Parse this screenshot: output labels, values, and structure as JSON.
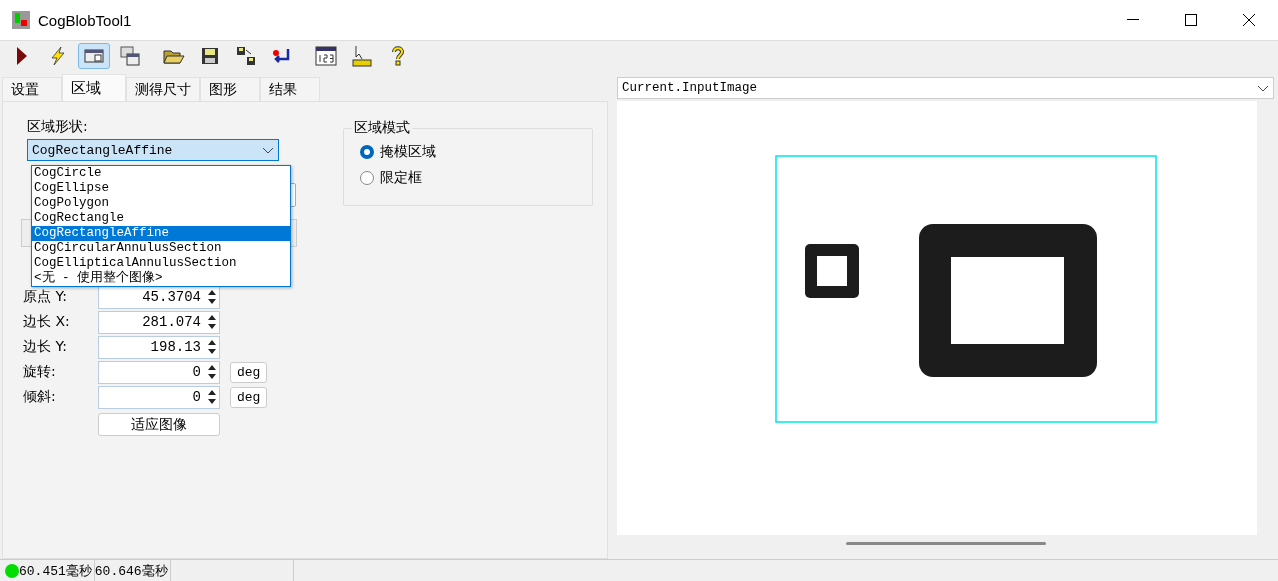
{
  "window": {
    "title": "CogBlobTool1"
  },
  "toolbar": [
    {
      "kind": "run",
      "selected": false
    },
    {
      "kind": "flash",
      "selected": false
    },
    {
      "kind": "panel",
      "selected": true
    },
    {
      "kind": "panels",
      "selected": false
    },
    {
      "kind": "open",
      "selected": false
    },
    {
      "kind": "save",
      "selected": false
    },
    {
      "kind": "saveas",
      "selected": false
    },
    {
      "kind": "reset",
      "selected": false
    },
    {
      "kind": "display",
      "selected": false
    },
    {
      "kind": "ruler",
      "selected": false
    },
    {
      "kind": "help",
      "selected": false
    }
  ],
  "tabs": [
    {
      "label": "设置",
      "selected": false
    },
    {
      "label": "区域",
      "selected": true
    },
    {
      "label": "测得尺寸",
      "selected": false
    },
    {
      "label": "图形",
      "selected": false
    },
    {
      "label": "结果",
      "selected": false
    }
  ],
  "region_shape": {
    "label": "区域形状:",
    "value": "CogRectangleAffine",
    "options": [
      {
        "label": "CogCircle",
        "selected": false
      },
      {
        "label": "CogEllipse",
        "selected": false
      },
      {
        "label": "CogPolygon",
        "selected": false
      },
      {
        "label": "CogRectangle",
        "selected": false
      },
      {
        "label": "CogRectangleAffine",
        "selected": true
      },
      {
        "label": "CogCircularAnnulusSection",
        "selected": false
      },
      {
        "label": "CogEllipticalAnnulusSection",
        "selected": false
      },
      {
        "label": "<无 - 使用整个图像>",
        "selected": false
      }
    ]
  },
  "fields": [
    {
      "label": "原点 Y:",
      "value": "45.3704"
    },
    {
      "label": "边长 X:",
      "value": "281.074"
    },
    {
      "label": "边长 Y:",
      "value": "198.13"
    },
    {
      "label": "旋转:",
      "value": "0",
      "unit": "deg"
    },
    {
      "label": "倾斜:",
      "value": "0",
      "unit": "deg"
    }
  ],
  "fit_button": "适应图像",
  "region_mode": {
    "title": "区域模式",
    "options": [
      {
        "label": "掩模区域",
        "selected": true
      },
      {
        "label": "限定框",
        "selected": false
      }
    ]
  },
  "image_selector": {
    "value": "Current.InputImage"
  },
  "status_bar": [
    {
      "text": "60.451毫秒",
      "color": "#00dd00"
    },
    {
      "text": "60.646毫秒"
    }
  ]
}
